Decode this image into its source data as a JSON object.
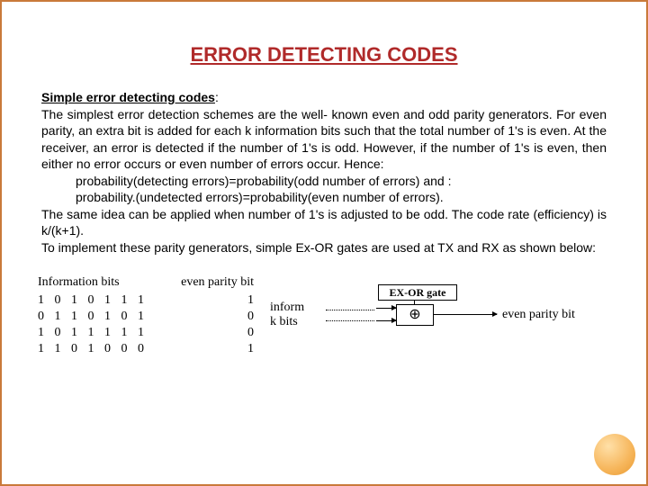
{
  "title": "ERROR DETECTING CODES",
  "subhead": "Simple error detecting codes",
  "colon": ":",
  "body": {
    "p1": "The simplest error detection schemes are the well- known even and odd parity generators. For even parity, an extra bit is added for each k information bits such that the total number of 1's is even. At the receiver, an error is detected if the number of 1's is odd.  However, if the number of 1's is even, then either no error occurs or  even number of errors occur. Hence:",
    "line1": "probability(detecting errors)=probability(odd number of errors) and :",
    "line2": "probability.(undetected errors)=probability(even number of errors).",
    "p2": "The same idea can be applied when number of 1's is adjusted to be odd. The code rate (efficiency) is k/(k+1).",
    "p3": "To implement these parity generators, simple Ex-OR gates are used at TX and RX as shown below:"
  },
  "table": {
    "head_info": "Information bits",
    "head_parity": "even parity bit",
    "rows": [
      {
        "bits": "1 0 1 0 1 1 1",
        "parity": "1"
      },
      {
        "bits": "0 1 1 0 1 0 1",
        "parity": "0"
      },
      {
        "bits": "1 0 1 1 1 1 1",
        "parity": "0"
      },
      {
        "bits": "1 1 0 1 0 0 0",
        "parity": "1"
      }
    ]
  },
  "diagram": {
    "in1": "inform",
    "in2": "k bits",
    "gate": "EX-OR gate",
    "xor": "⊕",
    "out": "even parity bit"
  }
}
